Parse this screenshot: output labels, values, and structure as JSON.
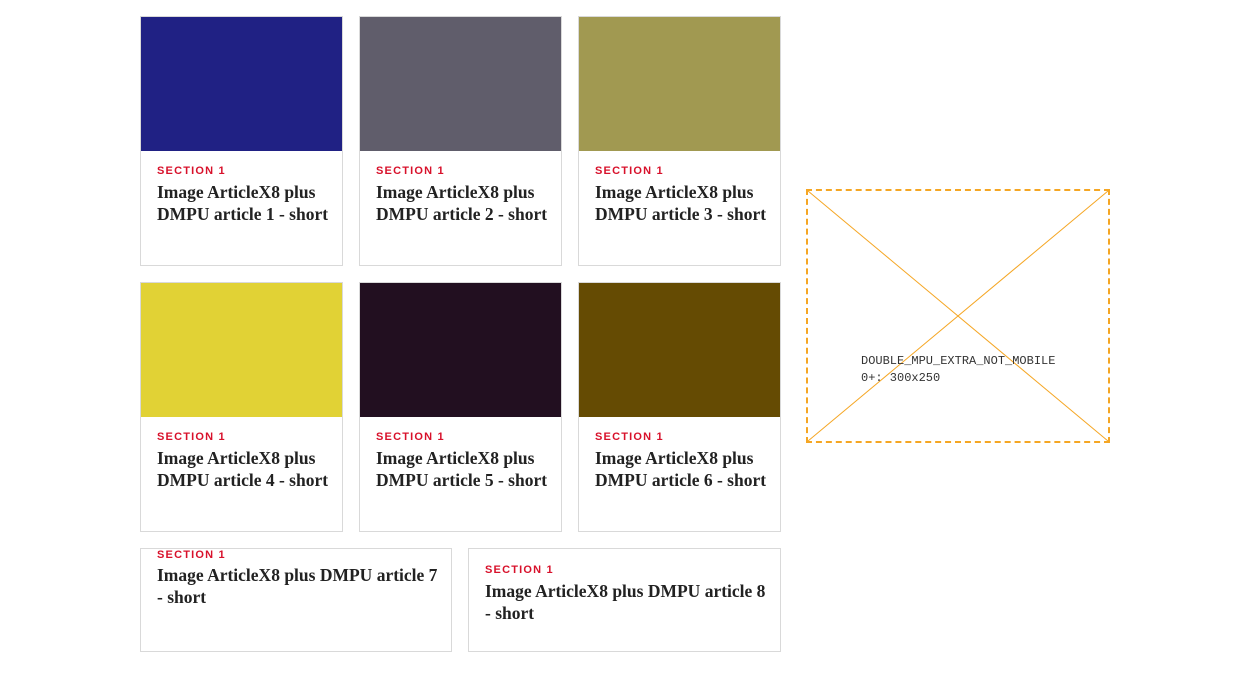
{
  "articles": [
    {
      "section": "SECTION 1",
      "title": "Image ArticleX8 plus DMPU article 1 - short",
      "image_color": "#202184"
    },
    {
      "section": "SECTION 1",
      "title": "Image ArticleX8 plus DMPU article 2 - short",
      "image_color": "#605d6b"
    },
    {
      "section": "SECTION 1",
      "title": "Image ArticleX8 plus DMPU article 3 - short",
      "image_color": "#a19951"
    },
    {
      "section": "SECTION 1",
      "title": "Image ArticleX8 plus DMPU article 4 - short",
      "image_color": "#e1d235"
    },
    {
      "section": "SECTION 1",
      "title": "Image ArticleX8 plus DMPU article 5 - short",
      "image_color": "#220f20"
    },
    {
      "section": "SECTION 1",
      "title": "Image ArticleX8 plus DMPU article 6 - short",
      "image_color": "#654b03"
    },
    {
      "section": "SECTION 1",
      "title": "Image ArticleX8 plus DMPU article 7 - short"
    },
    {
      "section": "SECTION 1",
      "title": "Image ArticleX8 plus DMPU article 8 - short"
    }
  ],
  "ad_slot": {
    "label_line1": "DOUBLE_MPU_EXTRA_NOT_MOBILE",
    "label_line2": "0+: 300x250",
    "border_color": "#f5a623"
  }
}
